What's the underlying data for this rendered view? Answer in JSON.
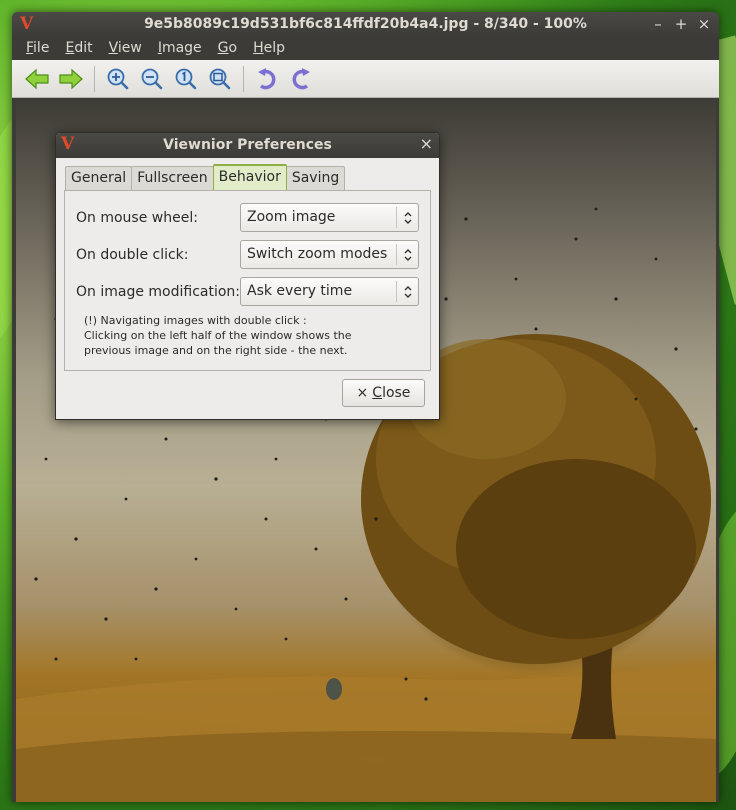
{
  "window": {
    "title": "9e5b8089c19d531bf6c814ffdf20b4a4.jpg - 8/340 - 100%",
    "controls": [
      "–",
      "+",
      "×"
    ]
  },
  "menubar": {
    "items": [
      {
        "accel": "F",
        "rest": "ile"
      },
      {
        "accel": "E",
        "rest": "dit"
      },
      {
        "accel": "V",
        "rest": "iew"
      },
      {
        "accel": "I",
        "rest": "mage"
      },
      {
        "accel": "G",
        "rest": "o"
      },
      {
        "accel": "H",
        "rest": "elp"
      }
    ]
  },
  "toolbar": {
    "icons": [
      "back-arrow-icon",
      "forward-arrow-icon",
      "zoom-in-icon",
      "zoom-out-icon",
      "zoom-normal-icon",
      "zoom-fit-icon",
      "rotate-left-icon",
      "rotate-right-icon"
    ],
    "colors": {
      "arrow": "#6fbf2a",
      "zoom": "#4f8fd6",
      "rotate": "#7a6ad6"
    }
  },
  "dialog": {
    "title": "Viewnior Preferences",
    "close_glyph": "×",
    "tabs": [
      "General",
      "Fullscreen",
      "Behavior",
      "Saving"
    ],
    "active_tab": "Behavior",
    "rows": [
      {
        "label": "On mouse wheel:",
        "value": "Zoom image"
      },
      {
        "label": "On double click:",
        "value": "Switch zoom modes"
      },
      {
        "label": "On image modification:",
        "value": "Ask every time"
      }
    ],
    "note": [
      "(!) Navigating images with double click :",
      "Clicking on the left half of the window shows the",
      "previous image and on the right side - the next."
    ],
    "close_button": {
      "glyph": "×",
      "accel": "C",
      "rest": "lose"
    }
  },
  "app_logo": "V",
  "accent": "#e24a2a"
}
